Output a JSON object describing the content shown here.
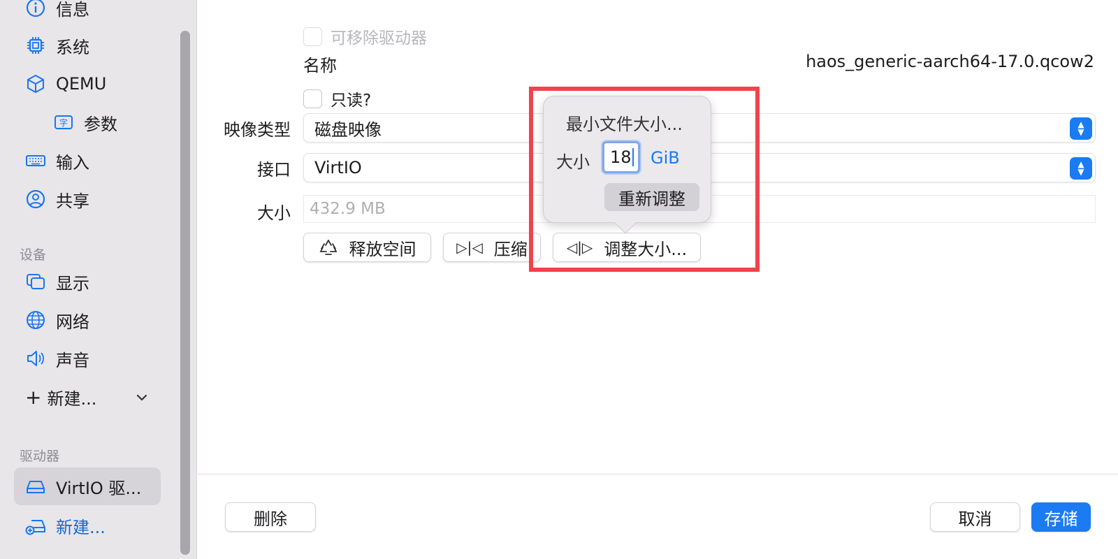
{
  "sidebar": {
    "items_top": [
      {
        "label": "信息",
        "icon": "info-icon"
      },
      {
        "label": "系统",
        "icon": "cpu-icon"
      },
      {
        "label": "QEMU",
        "icon": "cube-icon"
      },
      {
        "label": "参数",
        "icon": "text-badge-icon",
        "badge": "字"
      },
      {
        "label": "输入",
        "icon": "keyboard-icon"
      },
      {
        "label": "共享",
        "icon": "person-circle-icon"
      }
    ],
    "devices_header": "设备",
    "devices": [
      {
        "label": "显示",
        "icon": "display-icon"
      },
      {
        "label": "网络",
        "icon": "globe-icon"
      },
      {
        "label": "声音",
        "icon": "speaker-icon"
      }
    ],
    "new_device": "新建...",
    "drives_header": "驱动器",
    "drives": [
      {
        "label": "VirtIO 驱...",
        "icon": "drive-icon",
        "selected": true
      }
    ],
    "new_drive": "新建..."
  },
  "form": {
    "removable_label": "可移除驱动器",
    "name_label": "名称",
    "name_value": "haos_generic-aarch64-17.0.qcow2",
    "readonly_label": "只读?",
    "image_type_label": "映像类型",
    "image_type_value": "磁盘映像",
    "interface_label": "接口",
    "interface_value": "VirtIO",
    "size_label": "大小",
    "size_value": "432.9 MB"
  },
  "actions": {
    "reclaim": "释放空间",
    "compress": "压缩",
    "resize": "调整大小..."
  },
  "popover": {
    "title": "最小文件大小...",
    "size_label": "大小",
    "size_value": "18",
    "unit": "GiB",
    "resize_button": "重新调整"
  },
  "footer": {
    "delete": "删除",
    "cancel": "取消",
    "save": "存储"
  },
  "colors": {
    "accent": "#1a7bf2",
    "highlight": "#f0434c"
  }
}
